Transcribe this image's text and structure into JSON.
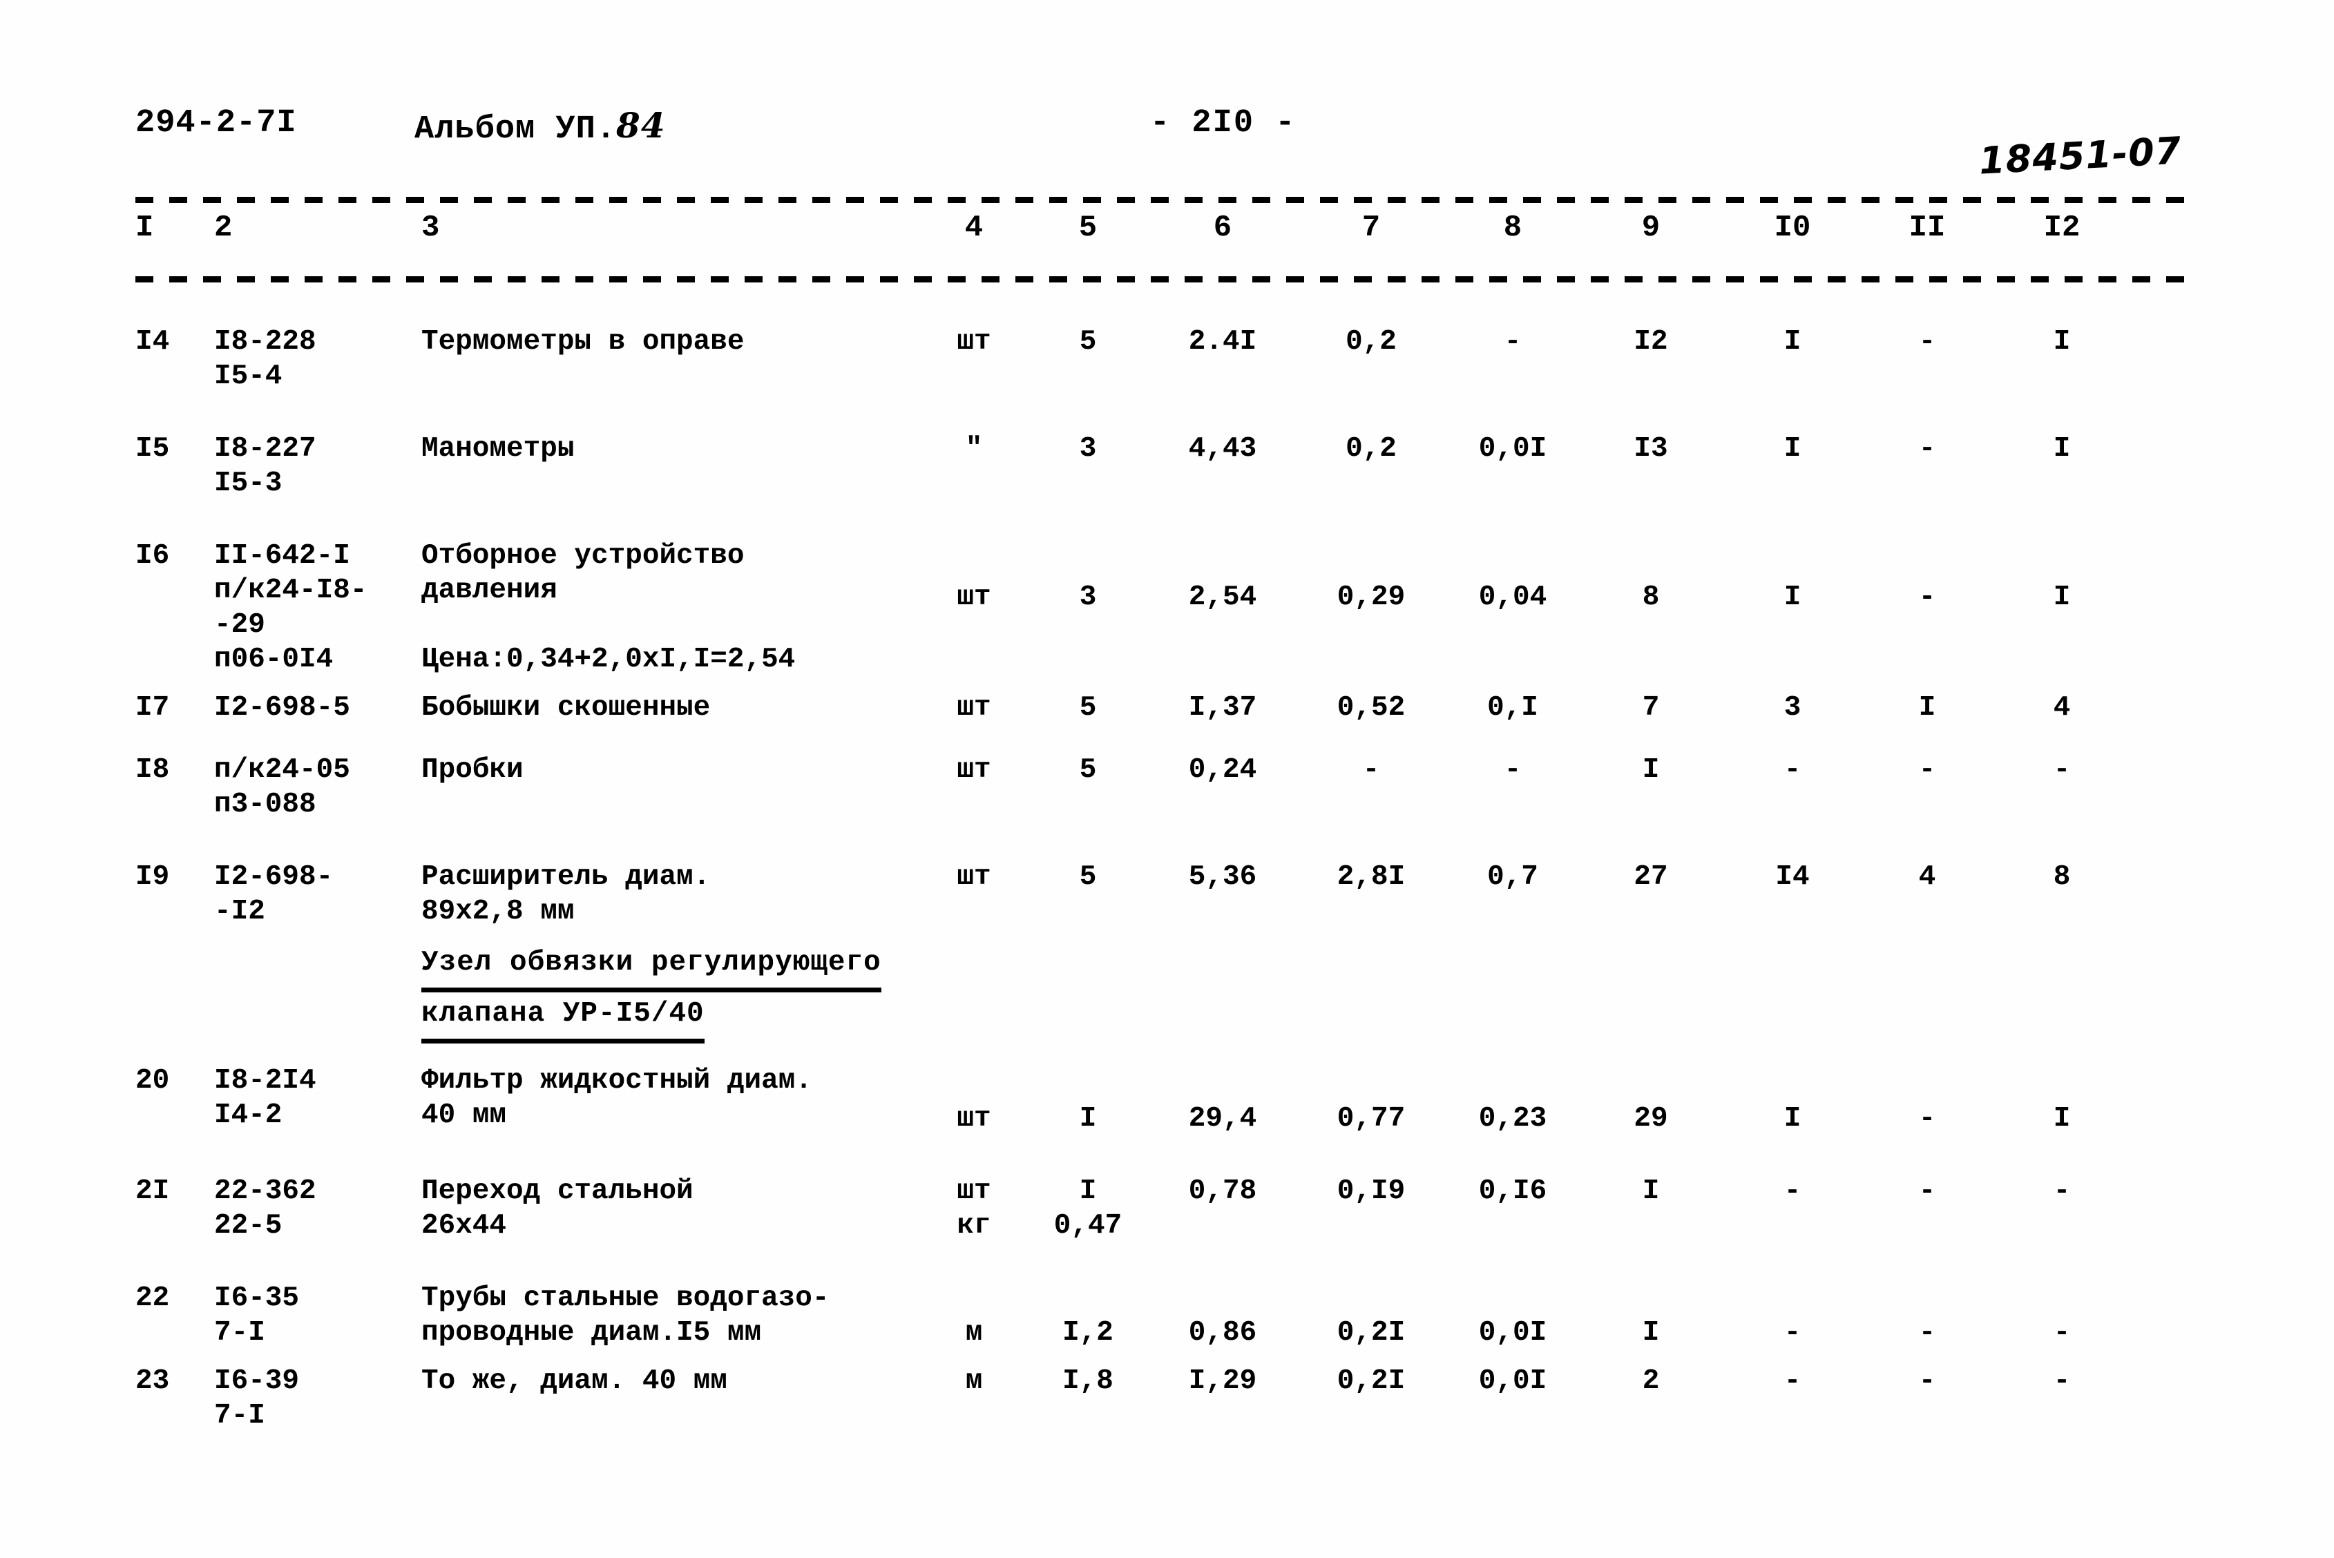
{
  "header": {
    "doc_code": "294-2-7I",
    "album_prefix": "Альбом УП.",
    "album_number": "84",
    "page_number": "- 2I0 -",
    "stamp_code": "18451-07"
  },
  "table": {
    "column_numbers": [
      "I",
      "2",
      "3",
      "4",
      "5",
      "6",
      "7",
      "8",
      "9",
      "I0",
      "II",
      "I2"
    ],
    "rows": [
      {
        "no": "I4",
        "code_lines": [
          "I8-228",
          "I5-4"
        ],
        "name_lines": [
          "Термометры в оправе"
        ],
        "unit_lines": [
          "шт"
        ],
        "c5_lines": [
          "5"
        ],
        "c6": "2.4I",
        "c7": "0,2",
        "c8": "-",
        "c9": "I2",
        "c10": "I",
        "c11": "-",
        "c12": "I"
      },
      {
        "no": "I5",
        "code_lines": [
          "I8-227",
          "I5-3"
        ],
        "name_lines": [
          "Манометры"
        ],
        "unit_lines": [
          "\""
        ],
        "c5_lines": [
          "3"
        ],
        "c6": "4,43",
        "c7": "0,2",
        "c8": "0,0I",
        "c9": "I3",
        "c10": "I",
        "c11": "-",
        "c12": "I"
      },
      {
        "no": "I6",
        "code_lines": [
          "II-642-I",
          "п/к24-I8-",
          "-29",
          "п06-0I4"
        ],
        "name_lines": [
          "Отборное устройство",
          "давления",
          "",
          "Цена:0,34+2,0xI,I=2,54"
        ],
        "unit_lines": [
          "шт"
        ],
        "c5_lines": [
          "3"
        ],
        "c6": "2,54",
        "c7": "0,29",
        "c8": "0,04",
        "c9": "8",
        "c10": "I",
        "c11": "-",
        "c12": "I"
      },
      {
        "no": "I7",
        "code_lines": [
          "I2-698-5"
        ],
        "name_lines": [
          "Бобышки скошенные"
        ],
        "unit_lines": [
          "шт"
        ],
        "c5_lines": [
          "5"
        ],
        "c6": "I,37",
        "c7": "0,52",
        "c8": "0,I",
        "c9": "7",
        "c10": "3",
        "c11": "I",
        "c12": "4"
      },
      {
        "no": "I8",
        "code_lines": [
          "п/к24-05",
          "п3-088"
        ],
        "name_lines": [
          "Пробки"
        ],
        "unit_lines": [
          "шт"
        ],
        "c5_lines": [
          "5"
        ],
        "c6": "0,24",
        "c7": "-",
        "c8": "-",
        "c9": "I",
        "c10": "-",
        "c11": "-",
        "c12": "-"
      },
      {
        "no": "I9",
        "code_lines": [
          "I2-698-",
          "-I2"
        ],
        "name_lines": [
          "Расширитель диам.",
          "89х2,8 мм"
        ],
        "unit_lines": [
          "шт"
        ],
        "c5_lines": [
          "5"
        ],
        "c6": "5,36",
        "c7": "2,8I",
        "c8": "0,7",
        "c9": "27",
        "c10": "I4",
        "c11": "4",
        "c12": "8"
      },
      {
        "no": "20",
        "code_lines": [
          "I8-2I4",
          "I4-2"
        ],
        "name_lines": [
          "Фильтр жидкостный диам.",
          "40 мм"
        ],
        "unit_lines": [
          "шт"
        ],
        "c5_lines": [
          "I"
        ],
        "c6": "29,4",
        "c7": "0,77",
        "c8": "0,23",
        "c9": "29",
        "c10": "I",
        "c11": "-",
        "c12": "I"
      },
      {
        "no": "2I",
        "code_lines": [
          "22-362",
          "22-5"
        ],
        "name_lines": [
          "Переход стальной",
          "26х44"
        ],
        "unit_lines": [
          "шт",
          "кг"
        ],
        "c5_lines": [
          "I",
          "0,47"
        ],
        "c6": "0,78",
        "c7": "0,I9",
        "c8": "0,I6",
        "c9": "I",
        "c10": "-",
        "c11": "-",
        "c12": "-"
      },
      {
        "no": "22",
        "code_lines": [
          "I6-35",
          "7-I"
        ],
        "name_lines": [
          "Трубы стальные водогазо-",
          "проводные диам.I5 мм"
        ],
        "unit_lines": [
          "м"
        ],
        "c5_lines": [
          "I,2"
        ],
        "c6": "0,86",
        "c7": "0,2I",
        "c8": "0,0I",
        "c9": "I",
        "c10": "-",
        "c11": "-",
        "c12": "-"
      },
      {
        "no": "23",
        "code_lines": [
          "I6-39",
          "7-I"
        ],
        "name_lines": [
          "То же, диам. 40 мм"
        ],
        "unit_lines": [
          "м"
        ],
        "c5_lines": [
          "I,8"
        ],
        "c6": "I,29",
        "c7": "0,2I",
        "c8": "0,0I",
        "c9": "2",
        "c10": "-",
        "c11": "-",
        "c12": "-"
      }
    ],
    "section_caption": {
      "line1": "Узел обвязки регулирующего",
      "line2": "клапана УР-I5/40"
    }
  }
}
